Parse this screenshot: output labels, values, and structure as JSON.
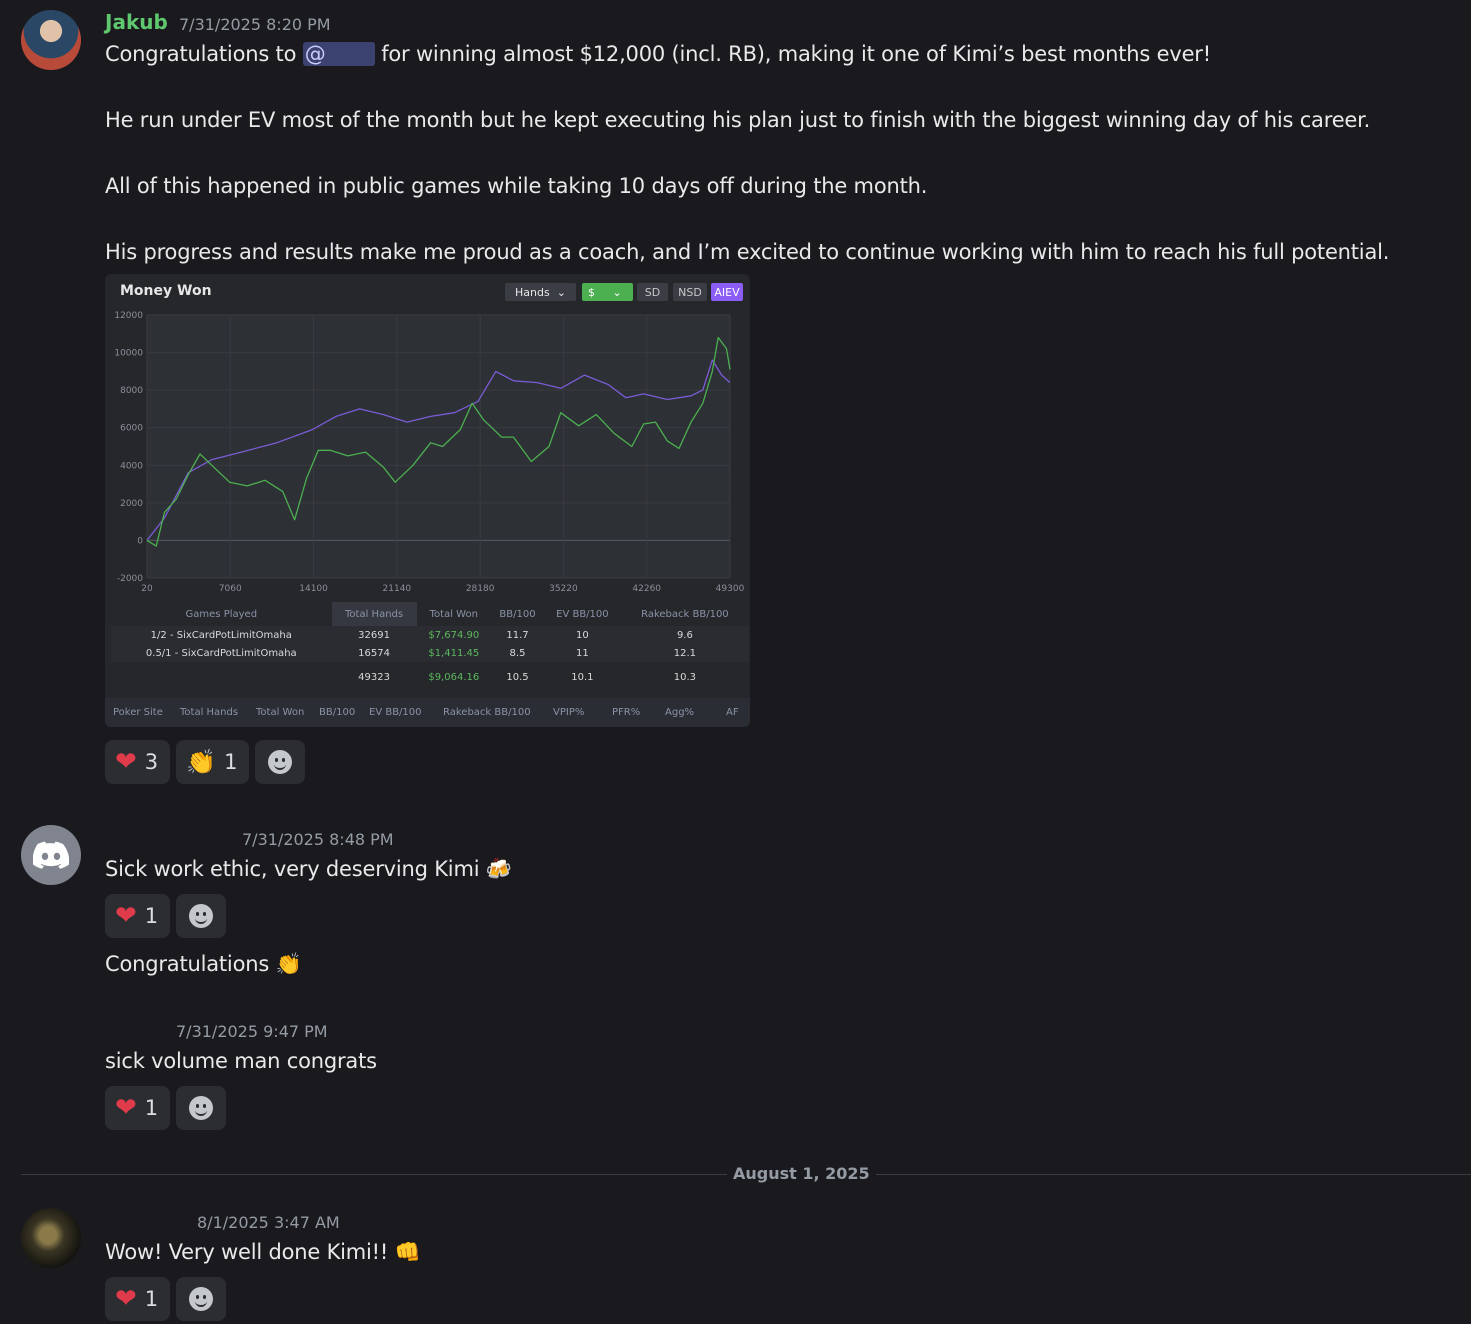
{
  "messages": {
    "m1": {
      "author": "Jakub",
      "author_color": "#5fc86e",
      "time": "7/31/2025 8:20 PM",
      "line1_pre": "Congratulations to",
      "mention": "@",
      "line1_post": "for winning almost $12,000 (incl. RB), making it one of Kimi’s best months ever!",
      "line2": "He run under EV most of the month but he kept executing his plan just to finish with the biggest winning day of his career.",
      "line3": "All of this happened in public games while taking 10 days off during the month.",
      "line4": "His progress and results make me proud as a coach, and I’m excited to continue working with him to reach his full potential.",
      "reactions": [
        {
          "emoji": "heart",
          "count": "3"
        },
        {
          "emoji": "clap",
          "count": "1"
        }
      ]
    },
    "m2": {
      "time": "7/31/2025 8:48 PM",
      "text": "Sick work ethic, very deserving Kimi",
      "text2": "Congratulations",
      "reactions": [
        {
          "emoji": "heart",
          "count": "1"
        }
      ]
    },
    "m3": {
      "time": "7/31/2025 9:47 PM",
      "text": "sick volume man congrats",
      "reactions": [
        {
          "emoji": "heart",
          "count": "1"
        }
      ]
    },
    "divider": "August 1, 2025",
    "m4": {
      "time": "8/1/2025 3:47 AM",
      "text": "Wow! Very well done Kimi!!",
      "reactions": [
        {
          "emoji": "heart",
          "count": "1"
        }
      ]
    }
  },
  "chart_card": {
    "title": "Money Won",
    "controls": {
      "hands": "Hands",
      "currency": "$",
      "sd": "SD",
      "nsd": "NSD",
      "aiev": "AIEV"
    },
    "table": {
      "headers": [
        "Games Played",
        "Total Hands",
        "Total Won",
        "BB/100",
        "EV BB/100",
        "Rakeback BB/100"
      ],
      "rows": [
        [
          "1/2 - SixCardPotLimitOmaha",
          "32691",
          "$7,674.90",
          "11.7",
          "10",
          "9.6"
        ],
        [
          "0.5/1 - SixCardPotLimitOmaha",
          "16574",
          "$1,411.45",
          "8.5",
          "11",
          "12.1"
        ],
        [
          "",
          "49323",
          "$9,064.16",
          "10.5",
          "10.1",
          "10.3"
        ]
      ]
    },
    "bottom_tabs": [
      "Poker Site",
      "Total Hands",
      "Total Won",
      "BB/100",
      "EV BB/100",
      "Rakeback BB/100",
      "VPIP%",
      "PFR%",
      "Agg%",
      "AF"
    ]
  },
  "chart_data": {
    "type": "line",
    "title": "Money Won",
    "xlabel": "",
    "ylabel": "",
    "x_ticks": [
      20,
      7060,
      14100,
      21140,
      28180,
      35220,
      42260,
      49300
    ],
    "y_ticks": [
      -2000,
      0,
      2000,
      4000,
      6000,
      8000,
      10000,
      12000
    ],
    "xlim": [
      20,
      49300
    ],
    "ylim": [
      -2000,
      12000
    ],
    "series": [
      {
        "color": "#7b5cd6",
        "x": [
          20,
          1500,
          3500,
          5500,
          8000,
          11000,
          14000,
          16000,
          18000,
          20000,
          22000,
          24000,
          26000,
          28000,
          29500,
          31000,
          33000,
          35000,
          37000,
          39000,
          40500,
          42000,
          44000,
          46000,
          47000,
          47800,
          48600,
          49300
        ],
        "y": [
          0,
          1200,
          3600,
          4300,
          4700,
          5200,
          5900,
          6600,
          7000,
          6700,
          6300,
          6600,
          6800,
          7400,
          9000,
          8500,
          8400,
          8100,
          8800,
          8300,
          7600,
          7800,
          7500,
          7700,
          8000,
          9600,
          8800,
          8400
        ]
      },
      {
        "color": "#4caf50",
        "x": [
          20,
          800,
          1500,
          2500,
          3500,
          4500,
          5500,
          7000,
          8500,
          10000,
          11500,
          12500,
          13500,
          14500,
          15500,
          17000,
          18500,
          20000,
          21000,
          22500,
          24000,
          25000,
          26500,
          27500,
          28500,
          30000,
          31000,
          32500,
          34000,
          35000,
          36500,
          38000,
          39500,
          41000,
          42000,
          43000,
          44000,
          45000,
          46000,
          47000,
          47800,
          48300,
          49000,
          49300
        ],
        "y": [
          0,
          -300,
          1500,
          2200,
          3500,
          4600,
          4000,
          3100,
          2900,
          3200,
          2600,
          1100,
          3300,
          4800,
          4800,
          4500,
          4700,
          3900,
          3100,
          4000,
          5200,
          5000,
          5900,
          7300,
          6400,
          5500,
          5500,
          4200,
          5000,
          6800,
          6100,
          6700,
          5700,
          5000,
          6200,
          6300,
          5300,
          4900,
          6300,
          7300,
          9000,
          10800,
          10200,
          9100
        ]
      }
    ]
  }
}
